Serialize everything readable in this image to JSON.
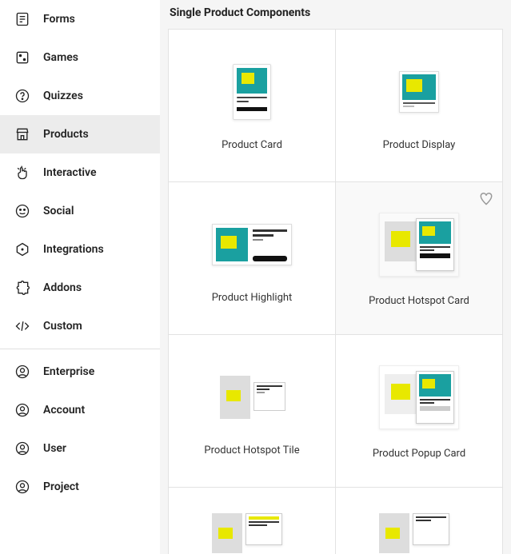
{
  "sidebar": {
    "items": [
      {
        "label": "Forms",
        "icon": "form-icon",
        "active": false
      },
      {
        "label": "Games",
        "icon": "dice-icon",
        "active": false
      },
      {
        "label": "Quizzes",
        "icon": "question-icon",
        "active": false
      },
      {
        "label": "Products",
        "icon": "store-icon",
        "active": true
      },
      {
        "label": "Interactive",
        "icon": "pointer-icon",
        "active": false
      },
      {
        "label": "Social",
        "icon": "social-icon",
        "active": false
      },
      {
        "label": "Integrations",
        "icon": "hexagon-icon",
        "active": false
      },
      {
        "label": "Addons",
        "icon": "puzzle-icon",
        "active": false
      },
      {
        "label": "Custom",
        "icon": "code-icon",
        "active": false
      }
    ],
    "account_items": [
      {
        "label": "Enterprise",
        "icon": "user-circle-icon"
      },
      {
        "label": "Account",
        "icon": "user-circle-icon"
      },
      {
        "label": "User",
        "icon": "user-circle-icon"
      },
      {
        "label": "Project",
        "icon": "user-circle-icon"
      }
    ]
  },
  "main": {
    "section_title": "Single Product Components",
    "cards": [
      {
        "label": "Product Card"
      },
      {
        "label": "Product Display"
      },
      {
        "label": "Product Highlight"
      },
      {
        "label": "Product Hotspot Card",
        "hovered": true
      },
      {
        "label": "Product Hotspot Tile"
      },
      {
        "label": "Product Popup Card"
      },
      {
        "label": ""
      },
      {
        "label": ""
      }
    ]
  }
}
